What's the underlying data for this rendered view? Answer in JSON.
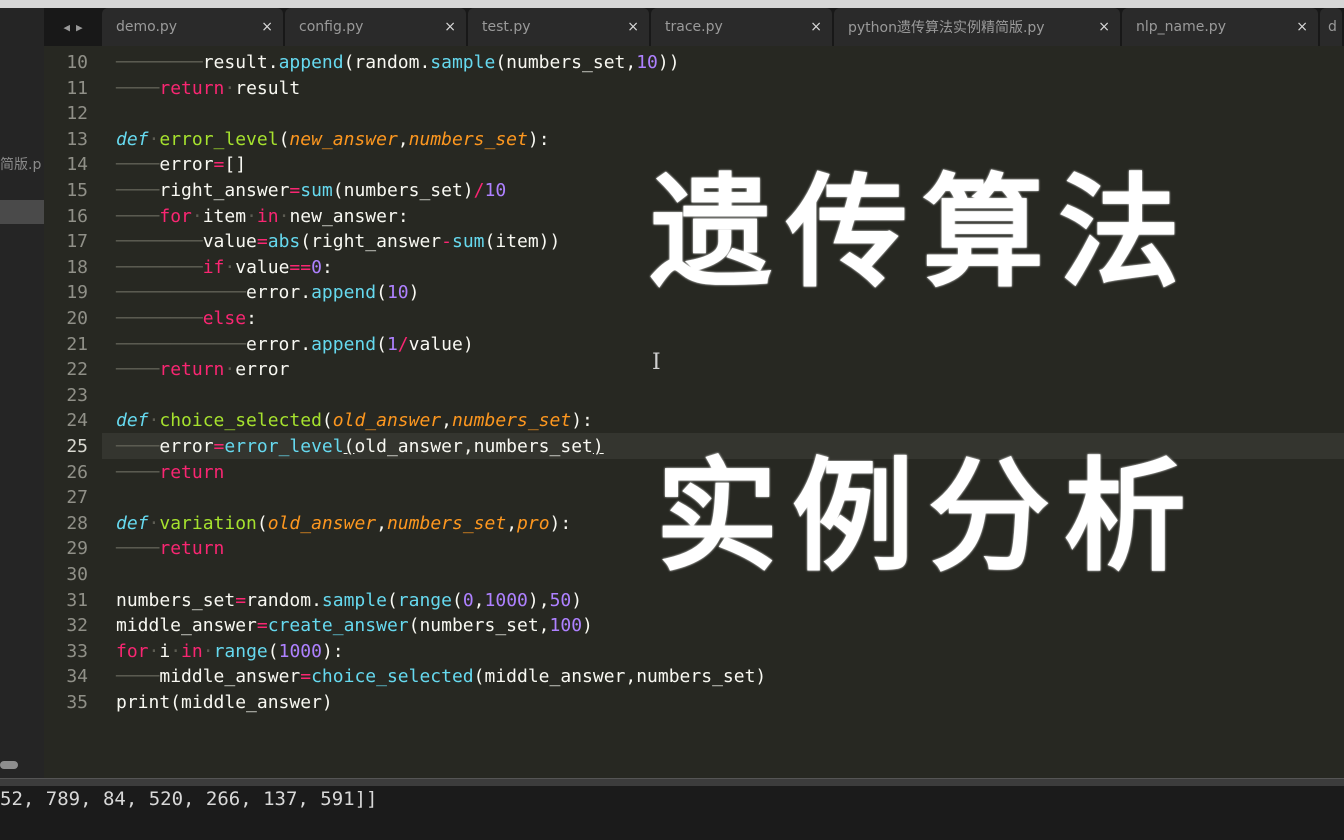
{
  "tabs": [
    {
      "label": "demo.py",
      "close": "×"
    },
    {
      "label": "config.py",
      "close": "×"
    },
    {
      "label": "test.py",
      "close": "×"
    },
    {
      "label": "trace.py",
      "close": "×"
    },
    {
      "label": "python遗传算法实例精简版.py",
      "close": "×"
    },
    {
      "label": "nlp_name.py",
      "close": "×"
    },
    {
      "label": "d",
      "close": ""
    }
  ],
  "tab_nav": {
    "prev": "◀",
    "next": "▶"
  },
  "sidebar": {
    "fragment": "简版.p"
  },
  "line_numbers": [
    "10",
    "11",
    "12",
    "13",
    "14",
    "15",
    "16",
    "17",
    "18",
    "19",
    "20",
    "21",
    "22",
    "23",
    "24",
    "25",
    "26",
    "27",
    "28",
    "29",
    "30",
    "31",
    "32",
    "33",
    "34",
    "35"
  ],
  "current_line": "25",
  "overlay": {
    "line1": "遗传算法",
    "line2": "实例分析"
  },
  "console": {
    "output": "52, 789, 84, 520, 266, 137, 591]]"
  },
  "colors": {
    "editor_bg": "#272822",
    "keyword": "#f92672",
    "function": "#a6e22e",
    "builtin": "#66d9ef",
    "number": "#ae81ff",
    "parameter": "#fd971f"
  }
}
